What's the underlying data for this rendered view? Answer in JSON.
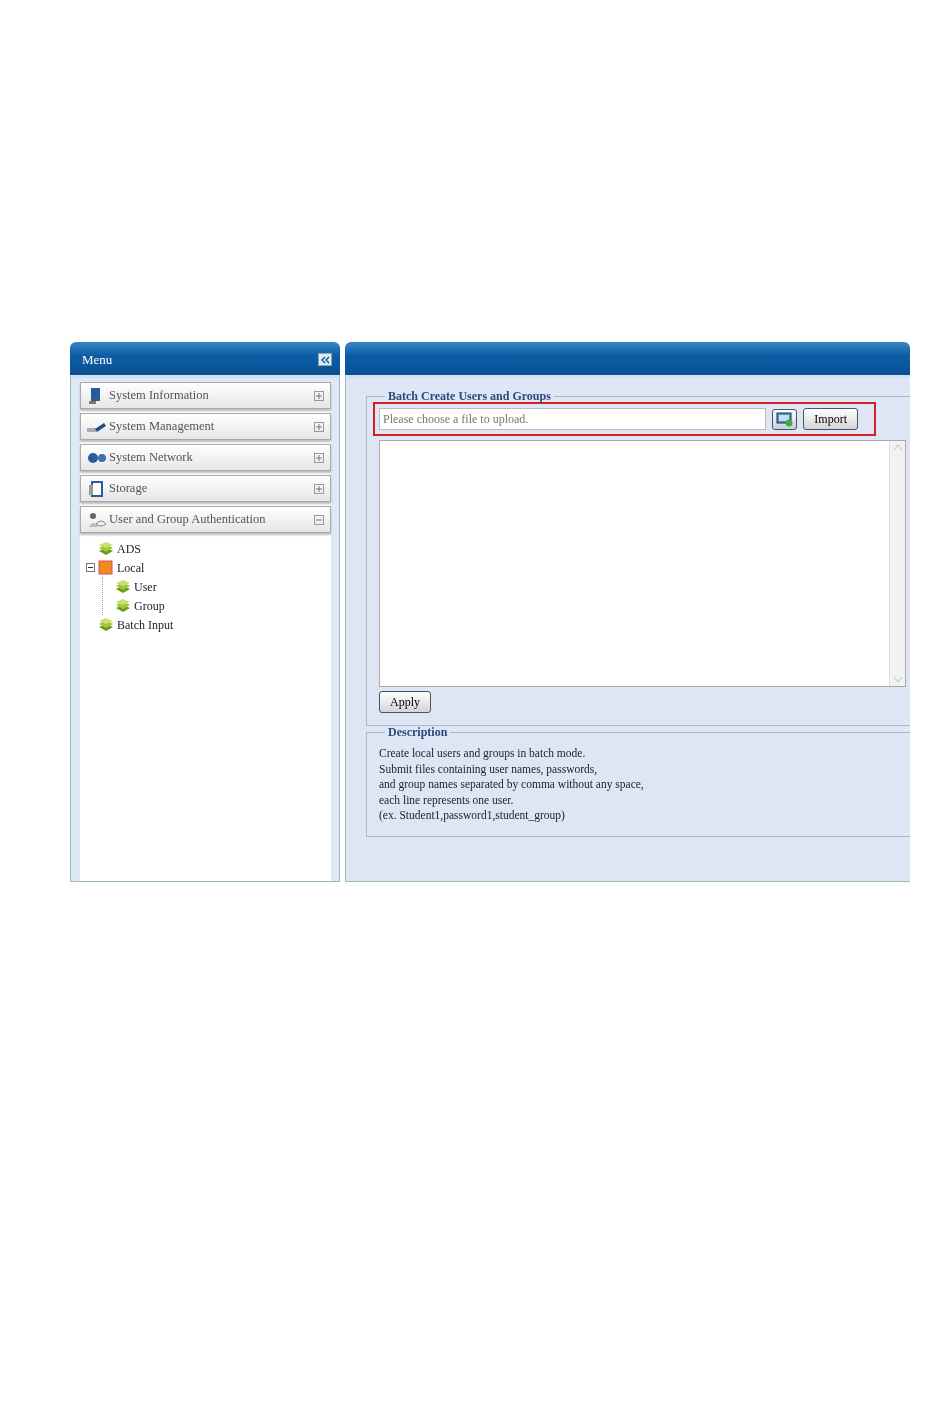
{
  "menu": {
    "title": "Menu",
    "sections": [
      {
        "label": "System Information",
        "expanded": false
      },
      {
        "label": "System Management",
        "expanded": false
      },
      {
        "label": "System Network",
        "expanded": false
      },
      {
        "label": "Storage",
        "expanded": false
      },
      {
        "label": "User and Group Authentication",
        "expanded": true,
        "children": [
          {
            "label": "ADS"
          },
          {
            "label": "Local",
            "expanded": true,
            "children": [
              {
                "label": "User"
              },
              {
                "label": "Group"
              }
            ]
          },
          {
            "label": "Batch Input"
          }
        ]
      }
    ]
  },
  "batch": {
    "title": "Batch Create Users and Groups",
    "file_field": {
      "placeholder": "Please choose a file to upload."
    },
    "import_button": "Import",
    "apply_button": "Apply"
  },
  "description": {
    "title": "Description",
    "lines": [
      "Create local users and groups in batch mode.",
      "Submit files containing user names, passwords,",
      "and group names separated by comma without any space,",
      "each line represents one user.",
      "(ex. Student1,password1,student_group)"
    ]
  }
}
